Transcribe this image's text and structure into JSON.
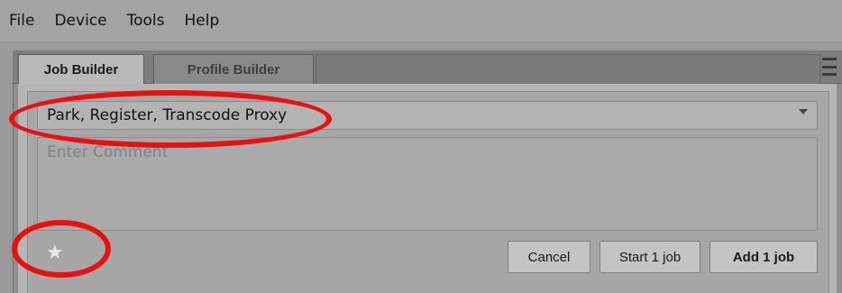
{
  "menu": {
    "items": [
      {
        "label": "File"
      },
      {
        "label": "Device"
      },
      {
        "label": "Tools"
      },
      {
        "label": "Help"
      }
    ]
  },
  "tabs": [
    {
      "label": "Job Builder",
      "active": true
    },
    {
      "label": "Profile Builder",
      "active": false
    }
  ],
  "builder": {
    "profile_value": "Park, Register, Transcode Proxy",
    "comment_placeholder": "Enter Comment",
    "star_icon": "star-icon",
    "buttons": {
      "cancel": "Cancel",
      "start": "Start 1 job",
      "add": "Add 1 job"
    }
  },
  "colors": {
    "annotation": "#e81010"
  }
}
